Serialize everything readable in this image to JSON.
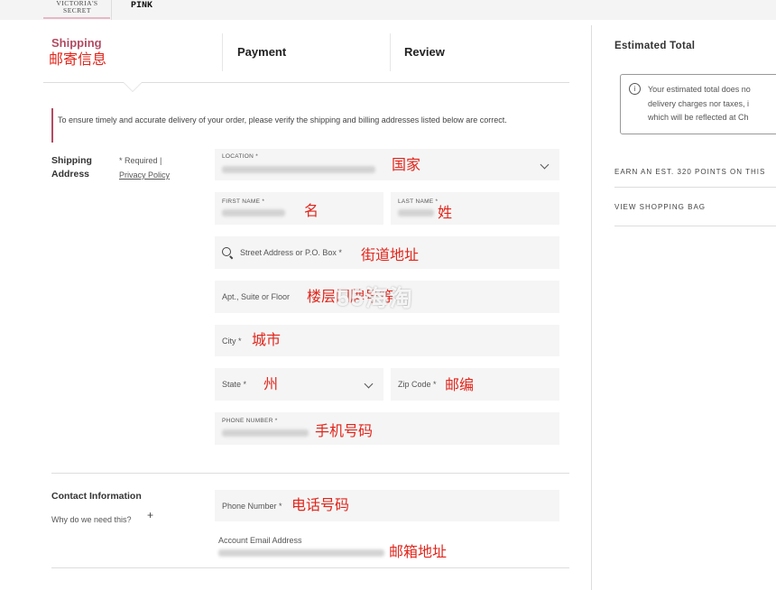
{
  "header": {
    "brand_vs": "VICTORIA'S SECRET",
    "brand_pink": "PINK"
  },
  "tabs": [
    {
      "label": "Shipping",
      "annotation": "邮寄信息"
    },
    {
      "label": "Payment"
    },
    {
      "label": "Review"
    }
  ],
  "notice": "To ensure timely and accurate delivery of your order, please verify the shipping and billing addresses listed below are correct.",
  "shipping": {
    "title": "Shipping Address",
    "required_note": "* Required |",
    "privacy_link": "Privacy Policy",
    "location": {
      "caption": "LOCATION *",
      "annotation": "国家"
    },
    "first_name": {
      "caption": "FIRST NAME *",
      "annotation": "名"
    },
    "last_name": {
      "caption": "LAST NAME *",
      "annotation": "姓"
    },
    "street": {
      "placeholder": "Street Address or P.O. Box *",
      "annotation": "街道地址"
    },
    "apt": {
      "placeholder": "Apt., Suite or Floor",
      "annotation": "楼层门牌号等"
    },
    "city": {
      "placeholder": "City *",
      "annotation": "城市"
    },
    "state": {
      "placeholder": "State *",
      "annotation": "州"
    },
    "zip": {
      "placeholder": "Zip Code *",
      "annotation": "邮编"
    },
    "phone": {
      "caption": "PHONE NUMBER *",
      "annotation": "手机号码"
    }
  },
  "contact": {
    "title": "Contact Information",
    "why": "Why do we need this?",
    "plus": "+",
    "phone": {
      "placeholder": "Phone Number *",
      "annotation": "电话号码"
    },
    "email": {
      "caption": "Account Email Address",
      "annotation": "邮箱地址"
    }
  },
  "summary": {
    "title": "Estimated Total",
    "info_icon": "i",
    "info_text": "Your estimated total does no\ndelivery charges nor taxes, i\nwhich will be reflected at Ch",
    "points": "EARN AN EST. 320 POINTS ON THIS",
    "bag_link": "VIEW SHOPPING BAG"
  },
  "watermark": "55海淘",
  "colors": {
    "accent": "#b24b63",
    "annotation": "#e1251b",
    "field_bg": "#f5f5f5"
  }
}
